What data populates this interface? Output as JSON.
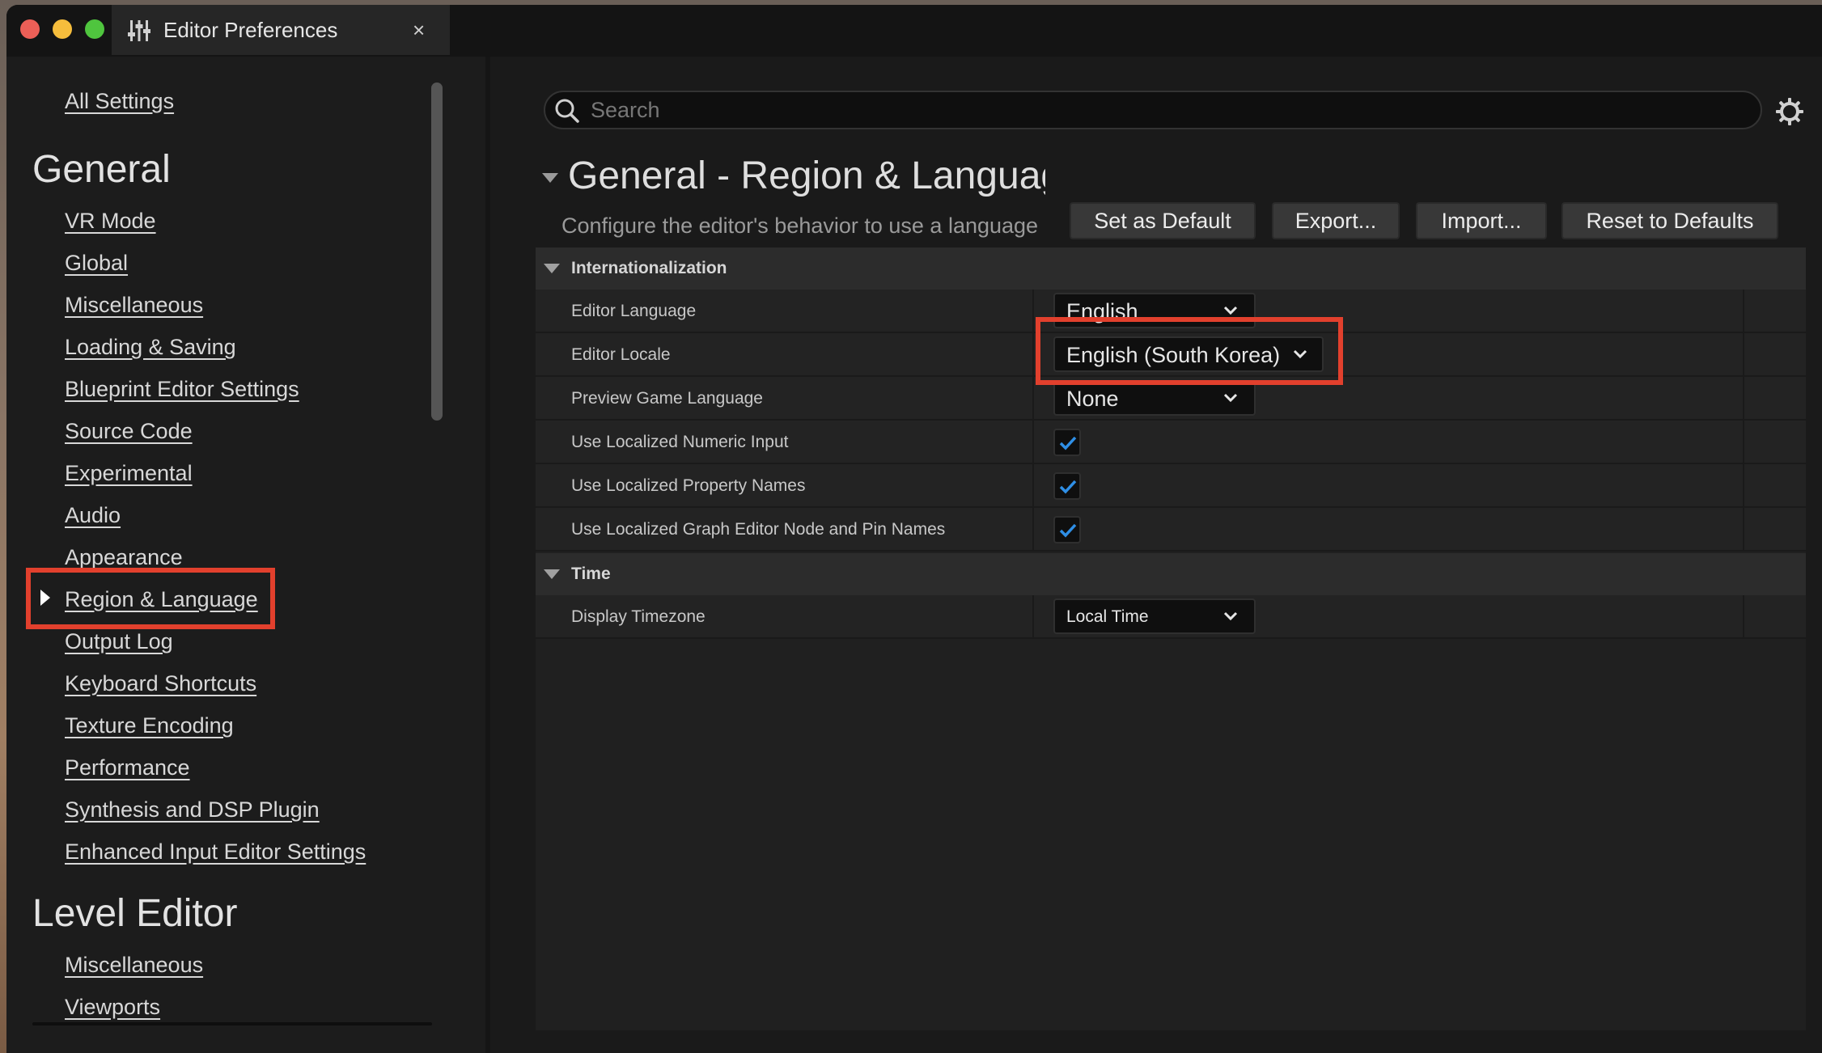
{
  "window": {
    "tab_title": "Editor Preferences",
    "close_glyph": "×",
    "controls": [
      "close",
      "minimize",
      "zoom"
    ]
  },
  "sidebar": {
    "all_settings": "All Settings",
    "groups": [
      {
        "heading": "General",
        "items": [
          {
            "label": "VR Mode"
          },
          {
            "label": "Global"
          },
          {
            "label": "Miscellaneous"
          },
          {
            "label": "Loading & Saving"
          },
          {
            "label": "Blueprint Editor Settings"
          },
          {
            "label": "Source Code"
          },
          {
            "label": "Experimental"
          },
          {
            "label": "Audio"
          },
          {
            "label": "Appearance"
          },
          {
            "label": "Region & Language",
            "selected": true
          },
          {
            "label": "Output Log"
          },
          {
            "label": "Keyboard Shortcuts"
          },
          {
            "label": "Texture Encoding"
          },
          {
            "label": "Performance"
          },
          {
            "label": "Synthesis and DSP Plugin"
          },
          {
            "label": "Enhanced Input Editor Settings"
          }
        ]
      },
      {
        "heading": "Level Editor",
        "items": [
          {
            "label": "Miscellaneous"
          },
          {
            "label": "Viewports"
          }
        ]
      }
    ]
  },
  "search": {
    "placeholder": "Search",
    "value": ""
  },
  "section": {
    "title": "General - Region & Language",
    "description": "Configure the editor's behavior to use a language",
    "buttons": {
      "set_default": "Set as Default",
      "export": "Export...",
      "import": "Import...",
      "reset": "Reset to Defaults"
    }
  },
  "categories": {
    "internationalization": {
      "label": "Internationalization",
      "properties": {
        "editor_language": {
          "name": "Editor Language",
          "value": "English"
        },
        "editor_locale": {
          "name": "Editor Locale",
          "value": "English (South Korea)"
        },
        "preview_game_language": {
          "name": "Preview Game Language",
          "value": "None"
        },
        "localized_numeric_input": {
          "name": "Use Localized Numeric Input",
          "checked": true
        },
        "localized_property_names": {
          "name": "Use Localized Property Names",
          "checked": true
        },
        "localized_graph_names": {
          "name": "Use Localized Graph Editor Node and Pin Names",
          "checked": true
        }
      }
    },
    "time": {
      "label": "Time",
      "properties": {
        "display_timezone": {
          "name": "Display Timezone",
          "value": "Local Time"
        }
      }
    }
  },
  "colors": {
    "highlight": "#e2402d",
    "checkmark": "#2f8fe6",
    "background": "#1a1a1a"
  },
  "icons": {
    "tab": "sliders-icon",
    "search": "search-icon",
    "settings": "gear-icon",
    "expand": "chevron-down-icon"
  }
}
